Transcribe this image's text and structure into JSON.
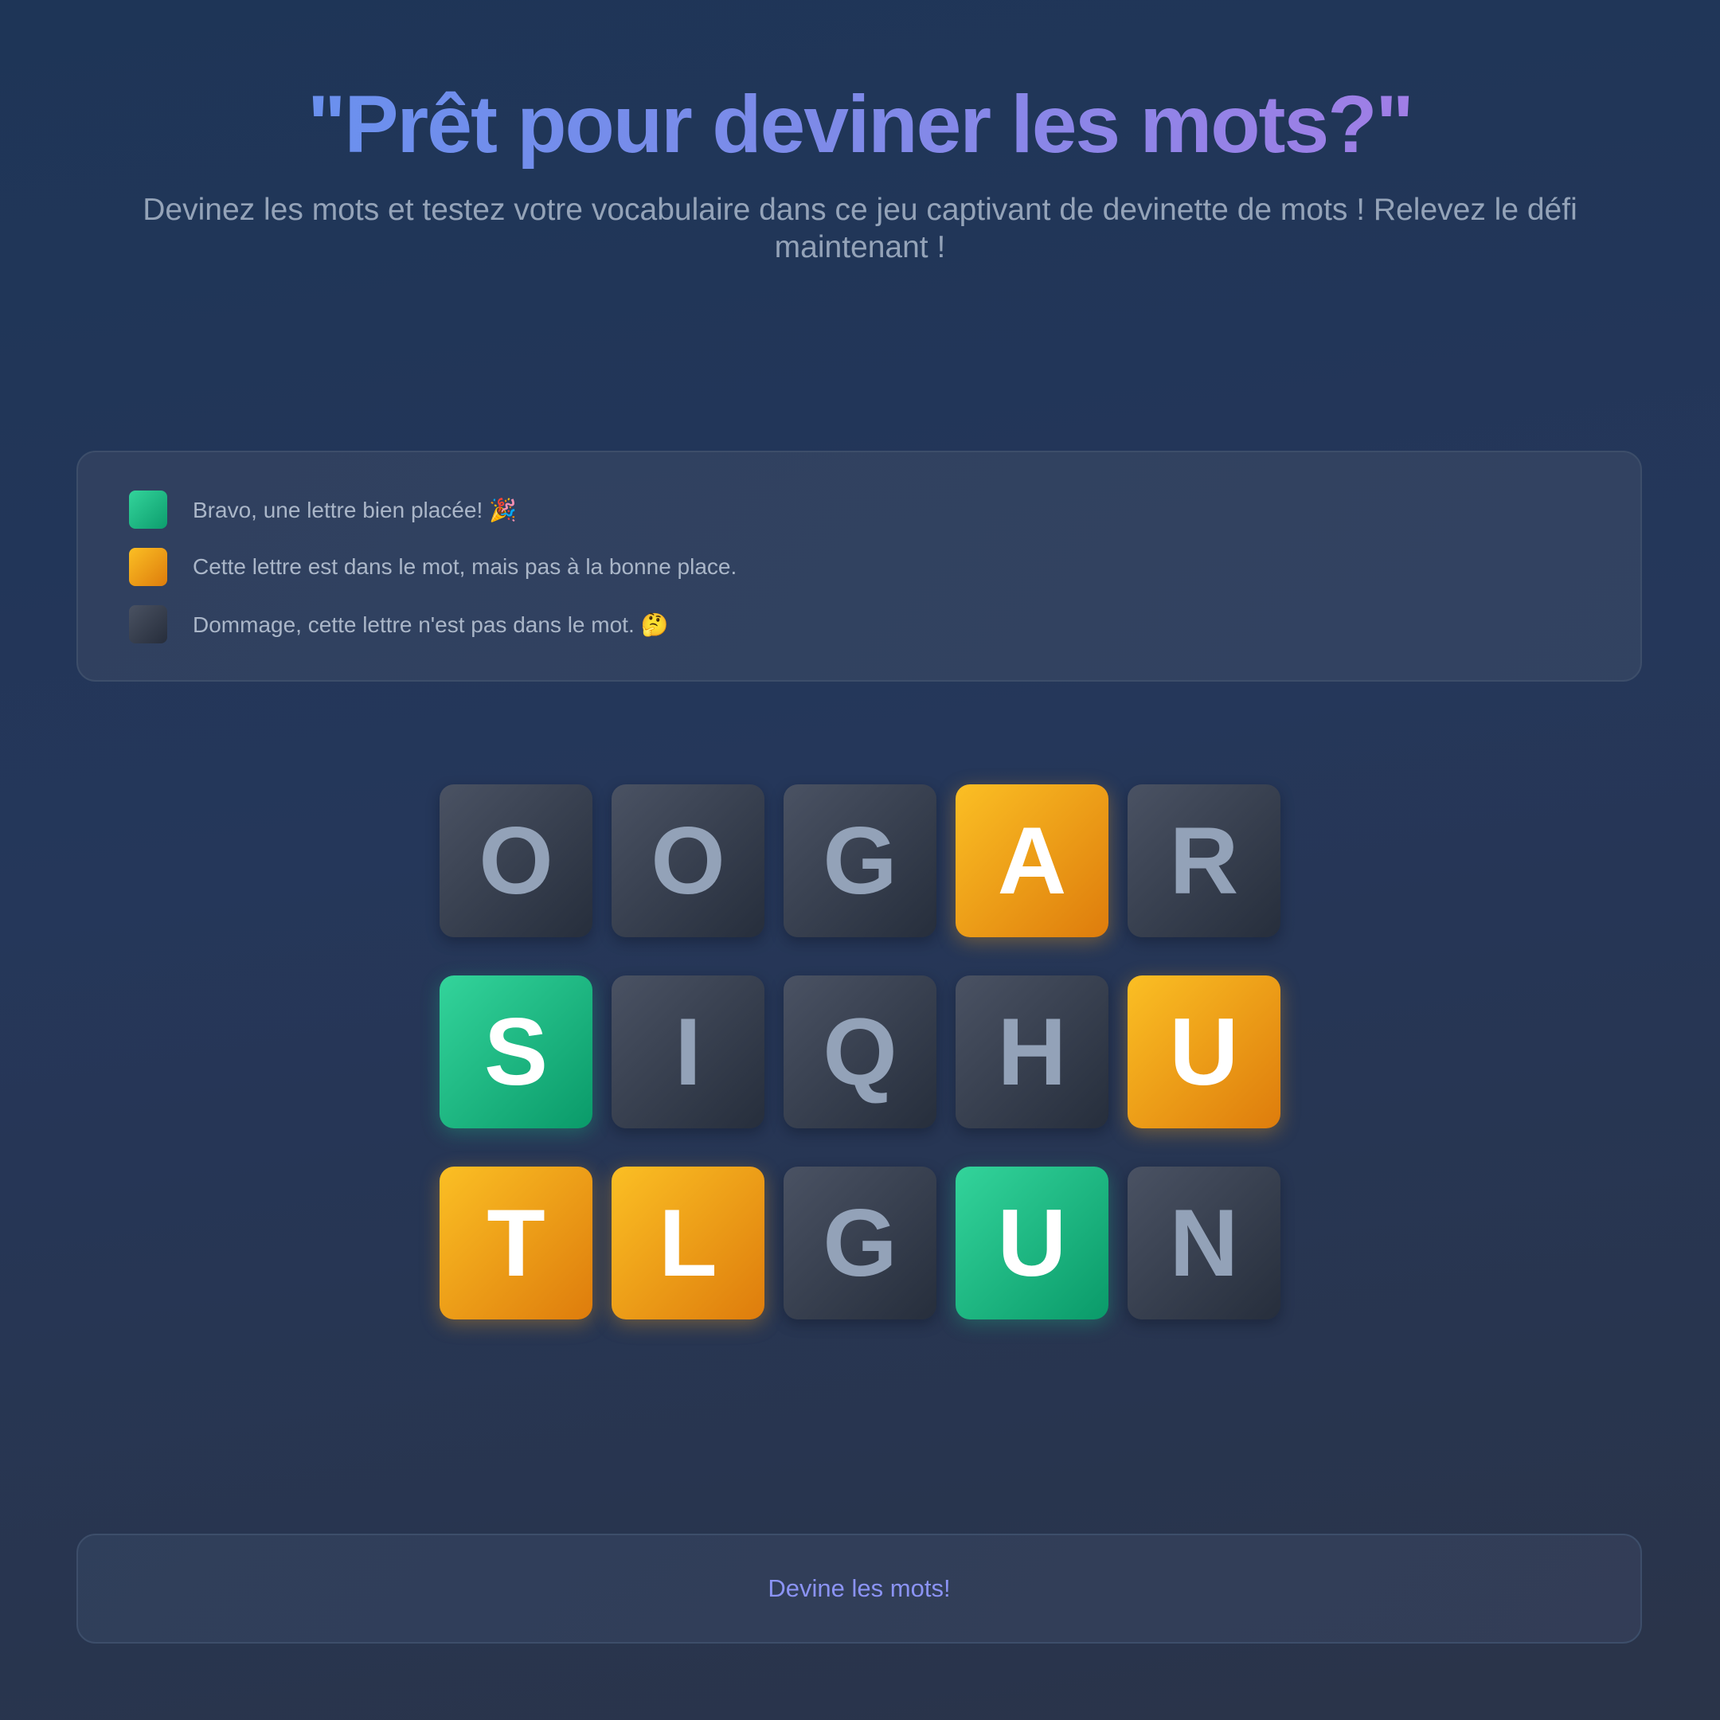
{
  "hero": {
    "title": "\"Prêt pour deviner les mots?\"",
    "subtitle": "Devinez les mots et testez votre vocabulaire dans ce jeu captivant de devinette de mots ! Relevez le défi maintenant !"
  },
  "legend": {
    "items": [
      {
        "status": "correct",
        "color": "#10b981",
        "text": "Bravo, une lettre bien placée!",
        "emoji": "🎉"
      },
      {
        "status": "present",
        "color": "#f59e0b",
        "text": "Cette lettre est dans le mot, mais pas à la bonne place.",
        "emoji": ""
      },
      {
        "status": "absent",
        "color": "#374151",
        "text": "Dommage, cette lettre n'est pas dans le mot.",
        "emoji": "🤔"
      }
    ]
  },
  "board": {
    "rows": [
      [
        {
          "letter": "O",
          "status": "absent"
        },
        {
          "letter": "O",
          "status": "absent"
        },
        {
          "letter": "G",
          "status": "absent"
        },
        {
          "letter": "A",
          "status": "present"
        },
        {
          "letter": "R",
          "status": "absent"
        }
      ],
      [
        {
          "letter": "S",
          "status": "correct"
        },
        {
          "letter": "I",
          "status": "absent"
        },
        {
          "letter": "Q",
          "status": "absent"
        },
        {
          "letter": "H",
          "status": "absent"
        },
        {
          "letter": "U",
          "status": "present"
        }
      ],
      [
        {
          "letter": "T",
          "status": "present"
        },
        {
          "letter": "L",
          "status": "present"
        },
        {
          "letter": "G",
          "status": "absent"
        },
        {
          "letter": "U",
          "status": "correct"
        },
        {
          "letter": "N",
          "status": "absent"
        }
      ]
    ]
  },
  "cta": {
    "label": "Devine les mots!"
  },
  "colors": {
    "correct": "#10b981",
    "present": "#f59e0b",
    "absent": "#374151",
    "accent": "#818cf8"
  }
}
